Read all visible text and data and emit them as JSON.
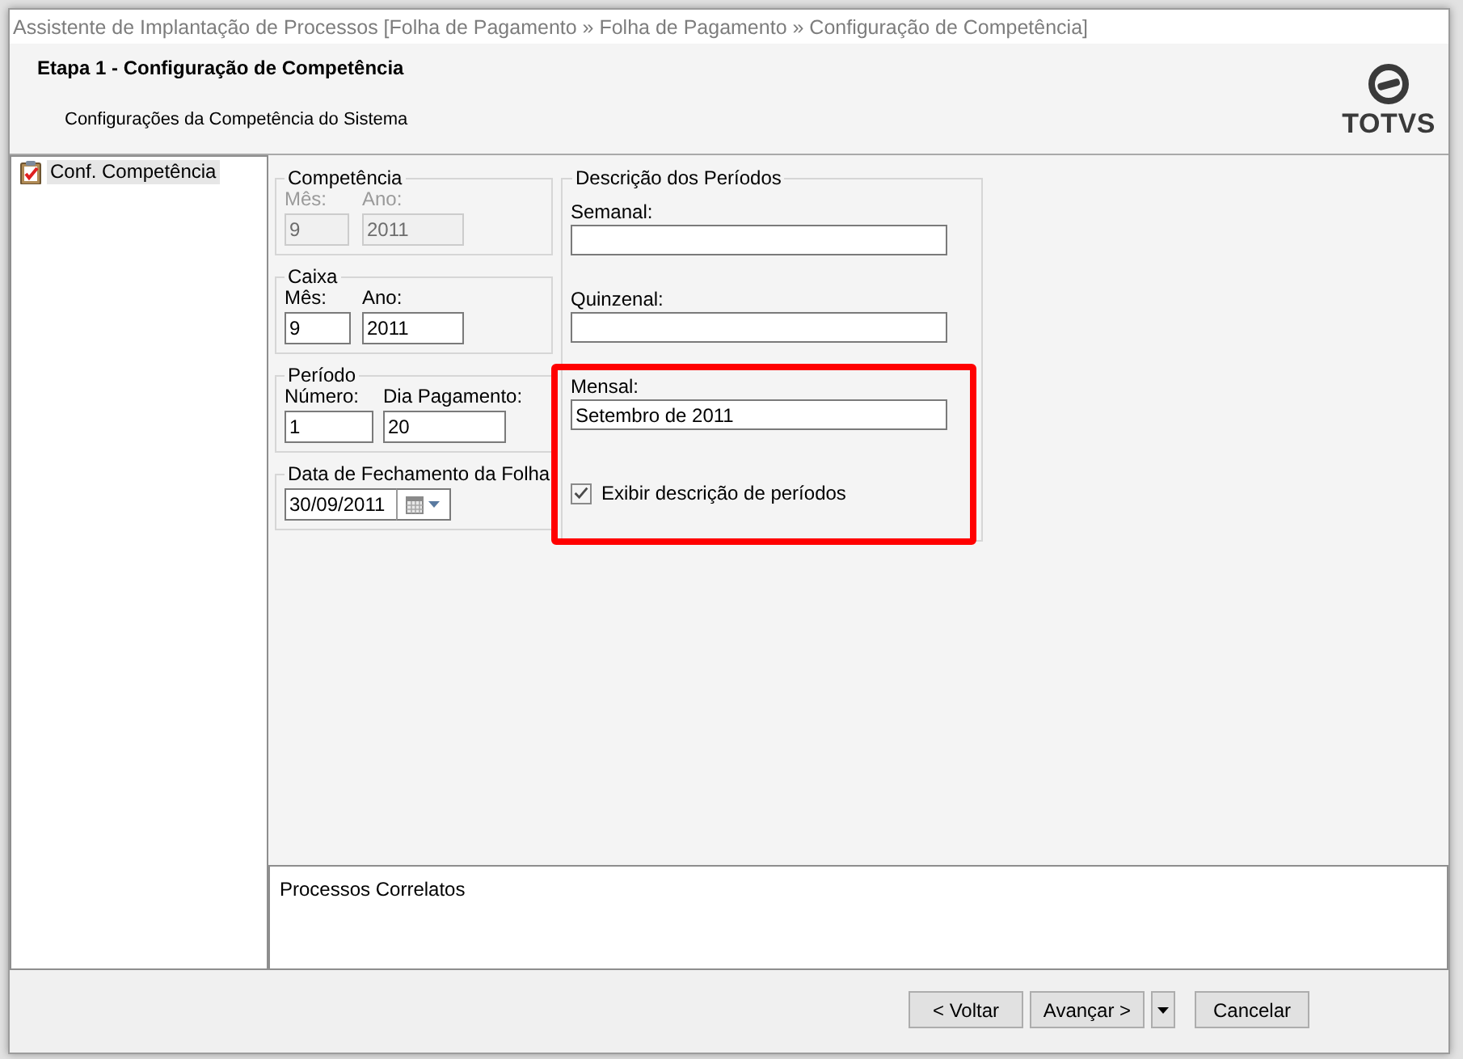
{
  "window": {
    "title": "Assistente de Implantação de Processos [Folha de Pagamento » Folha de Pagamento » Configuração de Competência]"
  },
  "header": {
    "step": "Etapa 1 - Configuração de Competência",
    "subtitle": "Configurações da Competência do Sistema",
    "logo": "TOTVS"
  },
  "sidebar": {
    "items": [
      {
        "label": "Conf. Competência",
        "selected": true
      }
    ]
  },
  "groups": [
    {
      "title": "Competência",
      "fields": [
        {
          "kind": "text",
          "label": "Mês:",
          "value": "9",
          "disabled": true
        },
        {
          "kind": "text",
          "label": "Ano:",
          "value": "2011",
          "disabled": true
        }
      ]
    },
    {
      "title": "Caixa",
      "fields": [
        {
          "kind": "text",
          "label": "Mês:",
          "value": "9",
          "disabled": false
        },
        {
          "kind": "text",
          "label": "Ano:",
          "value": "2011",
          "disabled": false
        }
      ]
    },
    {
      "title": "Período",
      "fields": [
        {
          "kind": "text",
          "label": "Número:",
          "value": "1",
          "disabled": false
        },
        {
          "kind": "text",
          "label": "Dia Pagamento:",
          "value": "20",
          "disabled": false
        }
      ]
    },
    {
      "title": "Data de Fechamento da Folha",
      "fields": [
        {
          "kind": "date",
          "value": "30/09/2011",
          "disabled": false
        }
      ]
    }
  ],
  "period_descriptions": {
    "title": "Descrição dos Períodos",
    "fields": [
      {
        "label": "Semanal:"
      },
      {
        "label": "Quinzenal:"
      },
      {
        "label": "Mensal:",
        "value": "Setembro de 2011"
      }
    ],
    "checkbox": {
      "label": "Exibir descrição de períodos",
      "checked": true
    }
  },
  "related": {
    "title": "Processos Correlatos"
  },
  "buttons": [
    {
      "kind": "plain",
      "label": "< Voltar"
    },
    {
      "kind": "split",
      "label": "Avançar >"
    },
    {
      "kind": "plain",
      "label": "Cancelar"
    }
  ]
}
